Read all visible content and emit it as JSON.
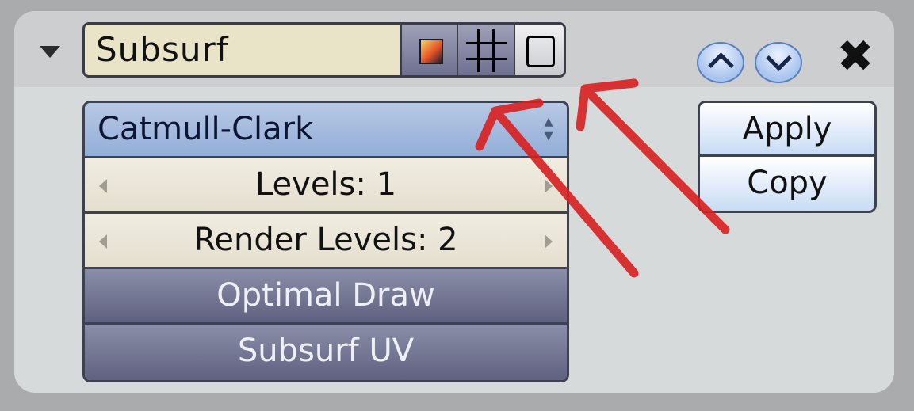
{
  "modifier": {
    "name": "Subsurf",
    "type_menu": {
      "selected": "Catmull-Clark"
    },
    "levels": "Levels: 1",
    "render_levels": "Render Levels: 2",
    "optimal_draw": "Optimal Draw",
    "subsurf_uv": "Subsurf UV",
    "apply_label": "Apply",
    "copy_label": "Copy",
    "delete_glyph": "✖"
  },
  "icons": {
    "collapse": "triangle-down-icon",
    "render_toggle": "render-icon",
    "editmode_toggle": "grid-icon",
    "cage_toggle": "cage-icon",
    "move_up": "chevron-up-icon",
    "move_down": "chevron-down-icon",
    "delete": "close-icon"
  },
  "colors": {
    "panel": "#d7dadb",
    "name_field": "#e9e4c7",
    "menu": "#a7bde0",
    "toggle_button": "#74779a",
    "annotation_arrow": "#d81f1f"
  }
}
